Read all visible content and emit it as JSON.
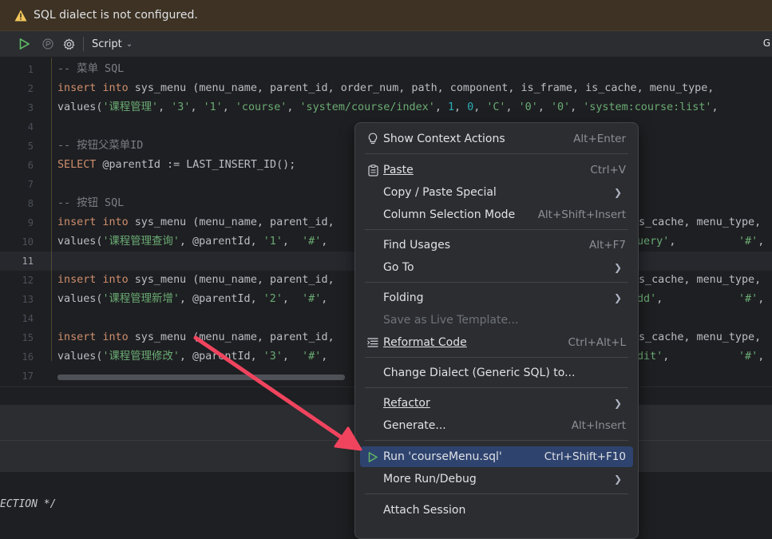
{
  "warning": {
    "text": "SQL dialect is not configured."
  },
  "toolbar": {
    "script_label": "Script",
    "right_fragment": "G"
  },
  "editor": {
    "line_numbers": [
      "1",
      "2",
      "3",
      "4",
      "5",
      "6",
      "7",
      "8",
      "9",
      "10",
      "11",
      "12",
      "13",
      "14",
      "15",
      "16",
      "17"
    ],
    "current_line": "11",
    "lines": {
      "l1": "-- 菜单 SQL",
      "l2": {
        "kw1": "insert into",
        "rest": " sys_menu (menu_name, parent_id, order_num, path, component, is_frame, is_cache, menu_type, "
      },
      "l3": {
        "p0": "values(",
        "s1": "'课程管理'",
        "c1": ", ",
        "s2": "'3'",
        "c2": ", ",
        "s3": "'1'",
        "c3": ", ",
        "s4": "'course'",
        "c4": ", ",
        "s5": "'system/course/index'",
        "c5": ", ",
        "n1": "1",
        "c6": ", ",
        "n2": "0",
        "c7": ", ",
        "s6": "'C'",
        "c8": ", ",
        "s7": "'0'",
        "c9": ", ",
        "s8": "'0'",
        "c10": ", ",
        "s9": "'system:course:list'",
        "c11": ","
      },
      "l5": "-- 按钮父菜单ID",
      "l6": {
        "kw": "SELECT",
        "rest": " @parentId := LAST_INSERT_ID();"
      },
      "l8": "-- 按钮 SQL",
      "l9": {
        "kw1": "insert into",
        "rest": " sys_menu (menu_name, parent_id,",
        "tail": "s_cache, menu_type, "
      },
      "l10": {
        "p0": "values(",
        "s1": "'课程管理查询'",
        "c1": ", @parentId, ",
        "s2": "'1'",
        "c2": ",  ",
        "s3": "'#'",
        "c3": ",",
        "tail1": "uery'",
        "tail2": ",",
        "tail3": "'#'",
        "tail4": ","
      },
      "l12": {
        "kw1": "insert into",
        "rest": " sys_menu (menu_name, parent_id,",
        "tail": "s_cache, menu_type, "
      },
      "l13": {
        "p0": "values(",
        "s1": "'课程管理新增'",
        "c1": ", @parentId, ",
        "s2": "'2'",
        "c2": ",  ",
        "s3": "'#'",
        "c3": ",",
        "tail1": "dd'",
        "tail2": ",",
        "tail3": "'#'",
        "tail4": ","
      },
      "l15": {
        "kw1": "insert into",
        "rest": " sys_menu (menu_name, parent_id,",
        "tail": "s_cache, menu_type, "
      },
      "l16": {
        "p0": "values(",
        "s1": "'课程管理修改'",
        "c1": ", @parentId, ",
        "s2": "'3'",
        "c2": ",  ",
        "s3": "'#'",
        "c3": ",",
        "tail1": "dit'",
        "tail2": ",",
        "tail3": "'#'",
        "tail4": ","
      }
    }
  },
  "bottom": {
    "text": "ECTION */"
  },
  "context_menu": {
    "show_context_actions": {
      "label": "Show Context Actions",
      "shortcut": "Alt+Enter"
    },
    "paste": {
      "label": "Paste",
      "shortcut": "Ctrl+V"
    },
    "copy_paste_special": {
      "label": "Copy / Paste Special"
    },
    "column_selection": {
      "label": "Column Selection Mode",
      "shortcut": "Alt+Shift+Insert"
    },
    "find_usages": {
      "label": "Find Usages",
      "shortcut": "Alt+F7"
    },
    "go_to": {
      "label": "Go To"
    },
    "folding": {
      "label": "Folding"
    },
    "save_live_template": {
      "label": "Save as Live Template..."
    },
    "reformat": {
      "label": "Reformat Code",
      "shortcut": "Ctrl+Alt+L"
    },
    "change_dialect": {
      "label": "Change Dialect (Generic SQL) to..."
    },
    "refactor": {
      "label": "Refactor"
    },
    "generate": {
      "label": "Generate...",
      "shortcut": "Alt+Insert"
    },
    "run": {
      "label": "Run 'courseMenu.sql'",
      "shortcut": "Ctrl+Shift+F10"
    },
    "more_run": {
      "label": "More Run/Debug"
    },
    "attach_session": {
      "label": "Attach Session"
    }
  },
  "colors": {
    "accent": "#2e436e",
    "keyword": "#cf8e6d",
    "string": "#6aab73",
    "number": "#2aacb8",
    "arrow": "#f0445e"
  },
  "icons": [
    "warning-icon",
    "run-icon",
    "pause-icon",
    "settings-icon",
    "lightbulb-icon",
    "clipboard-icon",
    "reformat-icon",
    "play-icon"
  ]
}
